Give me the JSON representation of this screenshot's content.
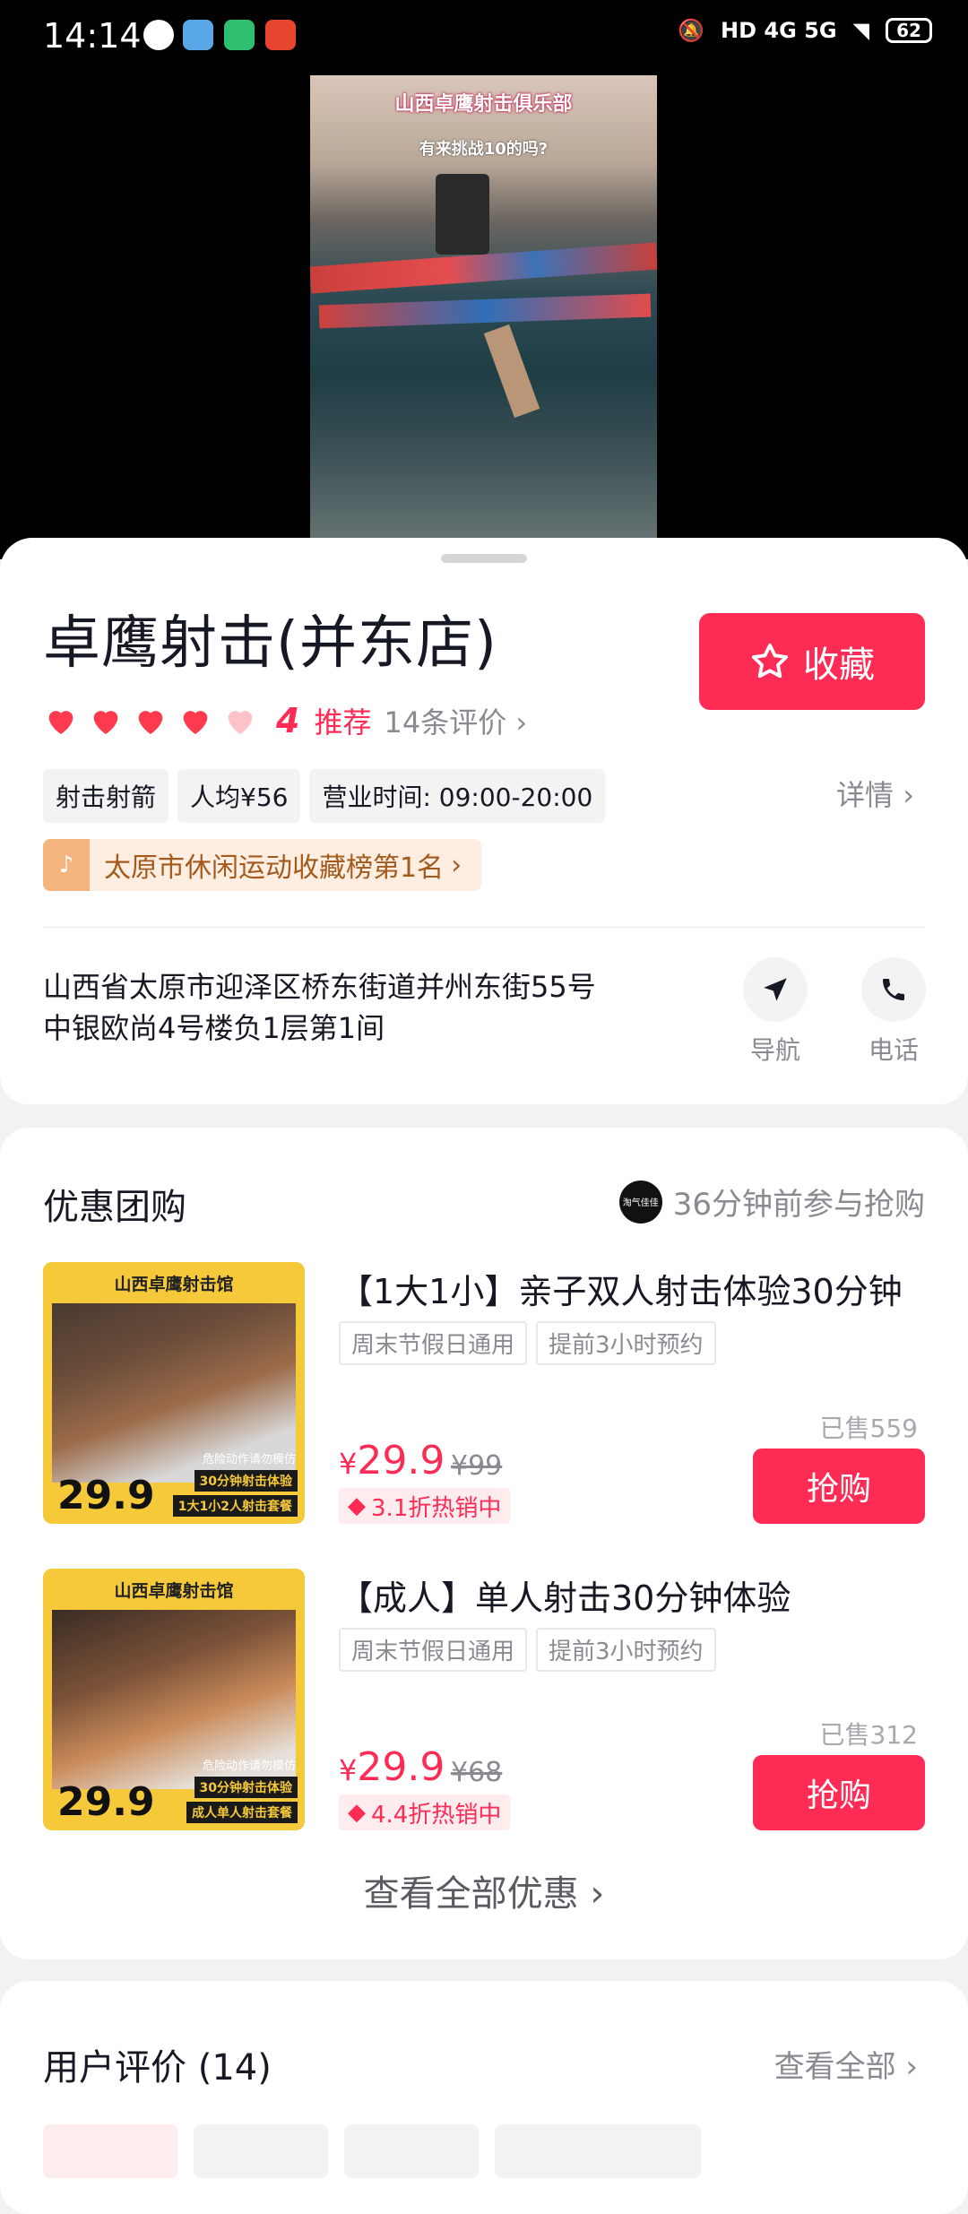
{
  "status_bar": {
    "time": "14:14",
    "network": "HD 4G 5G",
    "battery": "62"
  },
  "video": {
    "title": "山西卓鹰射击俱乐部",
    "subtitle": "有来挑战10的吗?"
  },
  "store": {
    "name": "卓鹰射击(并东店)",
    "favorite_label": "收藏",
    "rating": "4",
    "rating_label": "推荐",
    "reviews_count": "14条评价",
    "tags": [
      "射击射箭",
      "人均¥56",
      "营业时间: 09:00-20:00"
    ],
    "details_label": "详情",
    "rank_badge": "太原市休闲运动收藏榜第1名",
    "address": "山西省太原市迎泽区桥东街道并州东街55号中银欧尚4号楼负1层第1间",
    "nav_label": "导航",
    "phone_label": "电话"
  },
  "deals": {
    "title": "优惠团购",
    "avatar_text": "淘气佳佳",
    "recent_activity": "36分钟前参与抢购",
    "items": [
      {
        "img_band": "山西卓鹰射击馆",
        "img_price": "29.9",
        "img_line1": "30分钟射击体验",
        "img_line2": "1大1小2人射击套餐",
        "img_warn": "危险动作请勿模仿",
        "name": "【1大1小】亲子双人射击体验30分钟",
        "tags": [
          "周末节假日通用",
          "提前3小时预约"
        ],
        "sold": "已售559",
        "currency": "¥",
        "price": "29.9",
        "original": "¥99",
        "discount": "3.1折热销中",
        "buy_label": "抢购"
      },
      {
        "img_band": "山西卓鹰射击馆",
        "img_price": "29.9",
        "img_line1": "30分钟射击体验",
        "img_line2": "成人单人射击套餐",
        "img_warn": "危险动作请勿模仿",
        "name": "【成人】单人射击30分钟体验",
        "tags": [
          "周末节假日通用",
          "提前3小时预约"
        ],
        "sold": "已售312",
        "currency": "¥",
        "price": "29.9",
        "original": "¥68",
        "discount": "4.4折热销中",
        "buy_label": "抢购"
      }
    ],
    "see_all": "查看全部优惠"
  },
  "reviews": {
    "title": "用户评价 (14)",
    "see_all": "查看全部"
  },
  "colors": {
    "accent": "#fe2c55",
    "rank_bg": "#fdeee1",
    "rank_text": "#a35a1c"
  }
}
